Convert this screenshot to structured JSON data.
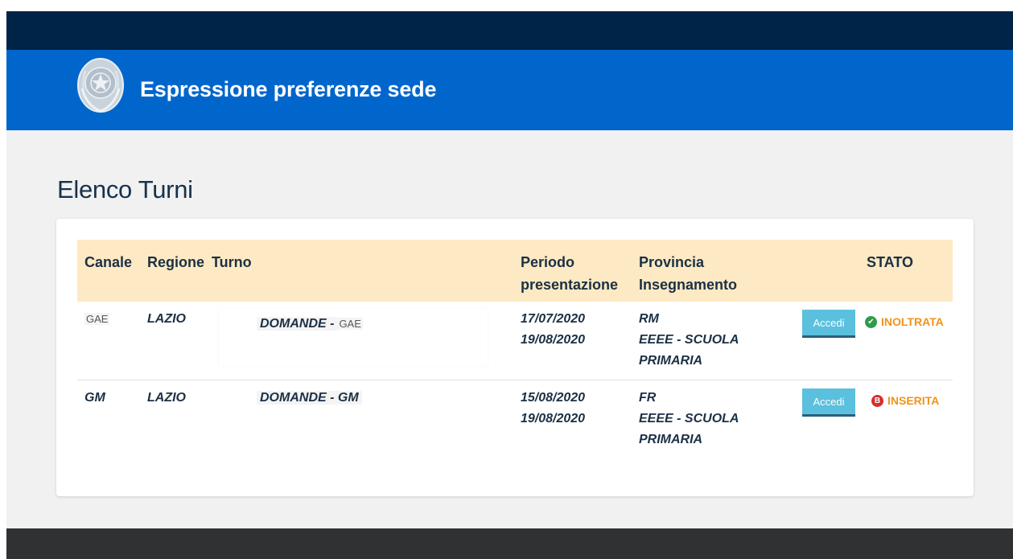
{
  "header": {
    "title": "Espressione preferenze sede",
    "emblem_icon": "italian-republic-emblem-icon"
  },
  "main": {
    "title": "Elenco Turni"
  },
  "table": {
    "headers": {
      "canale": "Canale",
      "regione": "Regione",
      "turno": "Turno",
      "periodo_1": "Periodo",
      "periodo_2": "presentazione",
      "provincia_1": "Provincia",
      "provincia_2": "Insegnamento",
      "stato": "STATO"
    },
    "rows": [
      {
        "canale": "GAE",
        "regione": "LAZIO",
        "turno_prefix": "DOMANDE -",
        "turno_suffix": "GAE",
        "data_inizio": "17/07/2020",
        "data_fine": "19/08/2020",
        "provincia": "RM",
        "insegnamento_1": "EEEE - SCUOLA",
        "insegnamento_2": "PRIMARIA",
        "button": "Accedi",
        "stato": "INOLTRATA",
        "stato_icon": "check-circle-icon",
        "stato_icon_glyph": "✔"
      },
      {
        "canale": "GM",
        "regione": "LAZIO",
        "turno": "DOMANDE - GM",
        "data_inizio": "15/08/2020",
        "data_fine": "19/08/2020",
        "provincia": "FR",
        "insegnamento_1": "EEEE - SCUOLA",
        "insegnamento_2": "PRIMARIA",
        "button": "Accedi",
        "stato": "INSERITA",
        "stato_icon": "error-circle-icon",
        "stato_icon_glyph": "B"
      }
    ]
  },
  "colors": {
    "top_bar": "#002447",
    "header": "#0066cc",
    "table_header": "#fde9c3",
    "button": "#5bc0de",
    "status_text": "#f0921c",
    "footer": "#2f3133"
  }
}
